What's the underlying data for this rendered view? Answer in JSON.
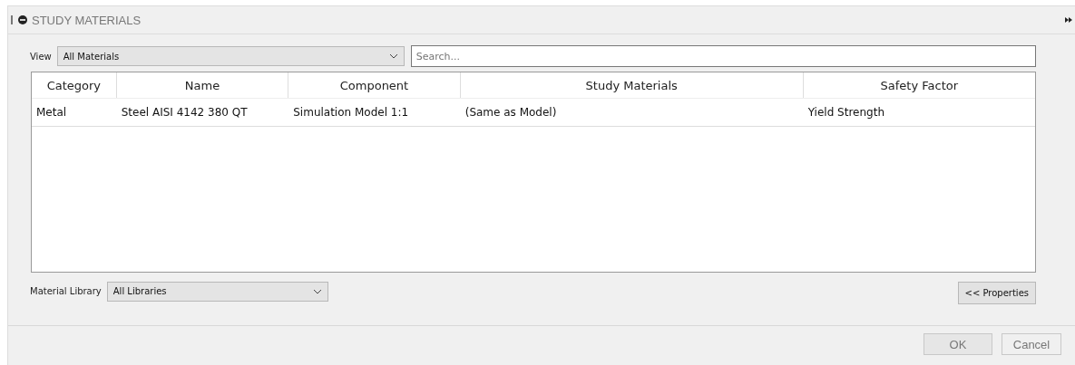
{
  "panel": {
    "title": "STUDY MATERIALS"
  },
  "view": {
    "label": "View",
    "value": "All Materials"
  },
  "search": {
    "placeholder": "Search..."
  },
  "table": {
    "columns": [
      {
        "label": "Category"
      },
      {
        "label": "Name"
      },
      {
        "label": "Component"
      },
      {
        "label": "Study Materials"
      },
      {
        "label": "Safety Factor"
      }
    ],
    "rows": [
      [
        "Metal",
        "Steel AISI 4142 380 QT",
        "Simulation Model 1:1",
        "(Same as Model)",
        "Yield Strength"
      ]
    ]
  },
  "library": {
    "label": "Material Library",
    "value": "All Libraries"
  },
  "properties_button": "<< Properties",
  "buttons": [
    "OK",
    "Cancel"
  ]
}
